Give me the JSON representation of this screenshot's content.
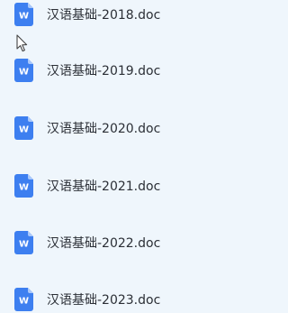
{
  "files": [
    {
      "name": "汉语基础-2018.doc",
      "icon": "word-doc-icon"
    },
    {
      "name": "汉语基础-2019.doc",
      "icon": "word-doc-icon"
    },
    {
      "name": "汉语基础-2020.doc",
      "icon": "word-doc-icon"
    },
    {
      "name": "汉语基础-2021.doc",
      "icon": "word-doc-icon"
    },
    {
      "name": "汉语基础-2022.doc",
      "icon": "word-doc-icon"
    },
    {
      "name": "汉语基础-2023.doc",
      "icon": "word-doc-icon"
    }
  ],
  "icon_letter": "W",
  "colors": {
    "background": "#eff6fc",
    "icon_blue": "#3d7ff0",
    "icon_fold": "#a9c8fb",
    "text": "#2b2f36"
  }
}
